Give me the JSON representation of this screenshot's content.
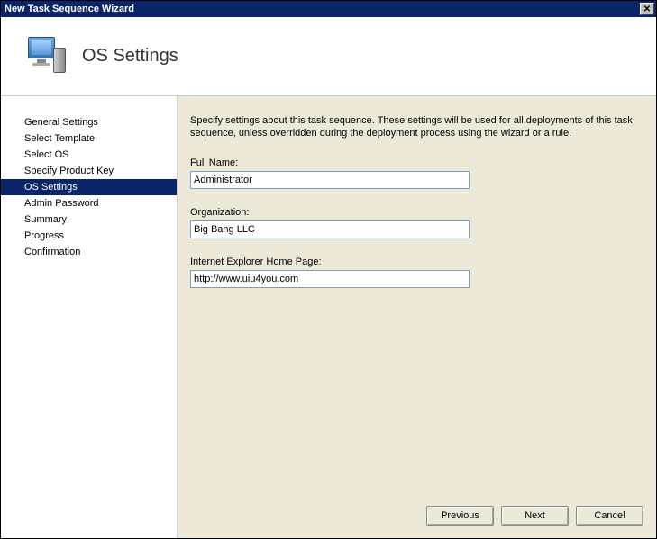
{
  "window": {
    "title": "New Task Sequence Wizard"
  },
  "header": {
    "title": "OS Settings"
  },
  "sidebar": {
    "items": [
      {
        "label": "General Settings",
        "selected": false
      },
      {
        "label": "Select Template",
        "selected": false
      },
      {
        "label": "Select OS",
        "selected": false
      },
      {
        "label": "Specify Product Key",
        "selected": false
      },
      {
        "label": "OS Settings",
        "selected": true
      },
      {
        "label": "Admin Password",
        "selected": false
      },
      {
        "label": "Summary",
        "selected": false
      },
      {
        "label": "Progress",
        "selected": false
      },
      {
        "label": "Confirmation",
        "selected": false
      }
    ]
  },
  "content": {
    "description": "Specify settings about this task sequence.  These settings will be used for all deployments of this task sequence, unless overridden during the deployment process using the wizard or a rule.",
    "fields": {
      "full_name": {
        "label": "Full Name:",
        "value": "Administrator"
      },
      "organization": {
        "label": "Organization:",
        "value": "Big Bang LLC"
      },
      "ie_home": {
        "label": "Internet Explorer Home Page:",
        "value": "http://www.uiu4you.com"
      }
    }
  },
  "buttons": {
    "previous": "Previous",
    "next": "Next",
    "cancel": "Cancel"
  }
}
